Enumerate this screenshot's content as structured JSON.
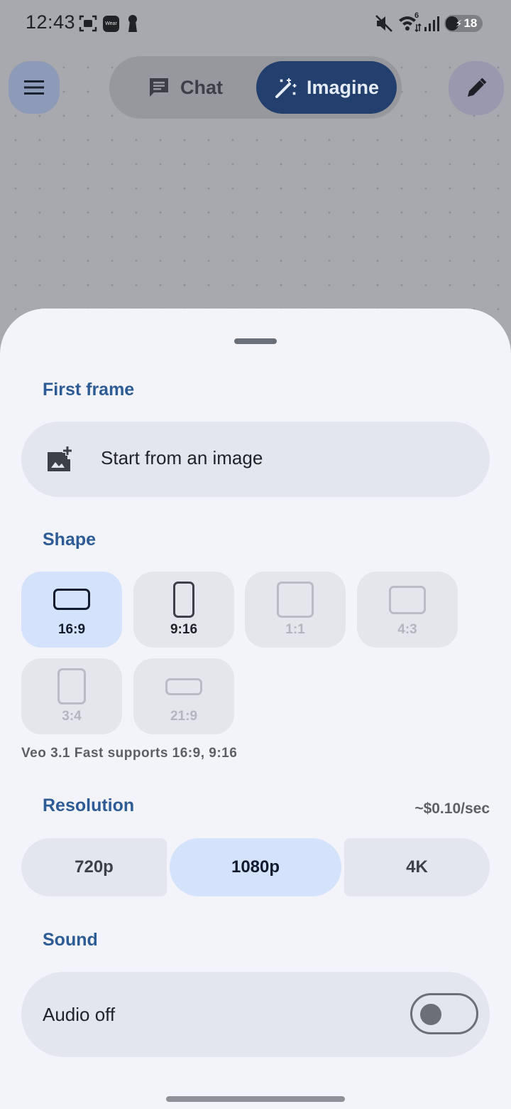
{
  "status_bar": {
    "time": "12:43",
    "wear_label": "Wear",
    "signal_badge": "6",
    "battery_level": "18"
  },
  "top_bar": {
    "menu_icon": "hamburger-menu-icon",
    "edit_icon": "pencil-icon",
    "mode_chat_label": "Chat",
    "mode_imagine_label": "Imagine",
    "selected_mode": "Imagine"
  },
  "sheet": {
    "first_frame_title": "First frame",
    "start_image_label": "Start from an image",
    "shape_title": "Shape",
    "shapes": [
      {
        "label": "16:9",
        "state": "selected"
      },
      {
        "label": "9:16",
        "state": "enabled"
      },
      {
        "label": "1:1",
        "state": "disabled"
      },
      {
        "label": "4:3",
        "state": "disabled"
      },
      {
        "label": "3:4",
        "state": "disabled"
      },
      {
        "label": "21:9",
        "state": "disabled"
      }
    ],
    "shape_note": "Veo 3.1 Fast supports 16:9, 9:16",
    "resolution_title": "Resolution",
    "price": "~$0.10/sec",
    "resolutions": [
      {
        "label": "720p",
        "selected": false
      },
      {
        "label": "1080p",
        "selected": true
      },
      {
        "label": "4K",
        "selected": false
      }
    ],
    "sound_title": "Sound",
    "audio_label": "Audio off",
    "audio_enabled": false
  },
  "colors": {
    "accent": "#2d5b96",
    "imagine_pill": "#233f6e",
    "selected_tile": "#d4e3fb",
    "sheet_bg": "#f2f4fa"
  }
}
